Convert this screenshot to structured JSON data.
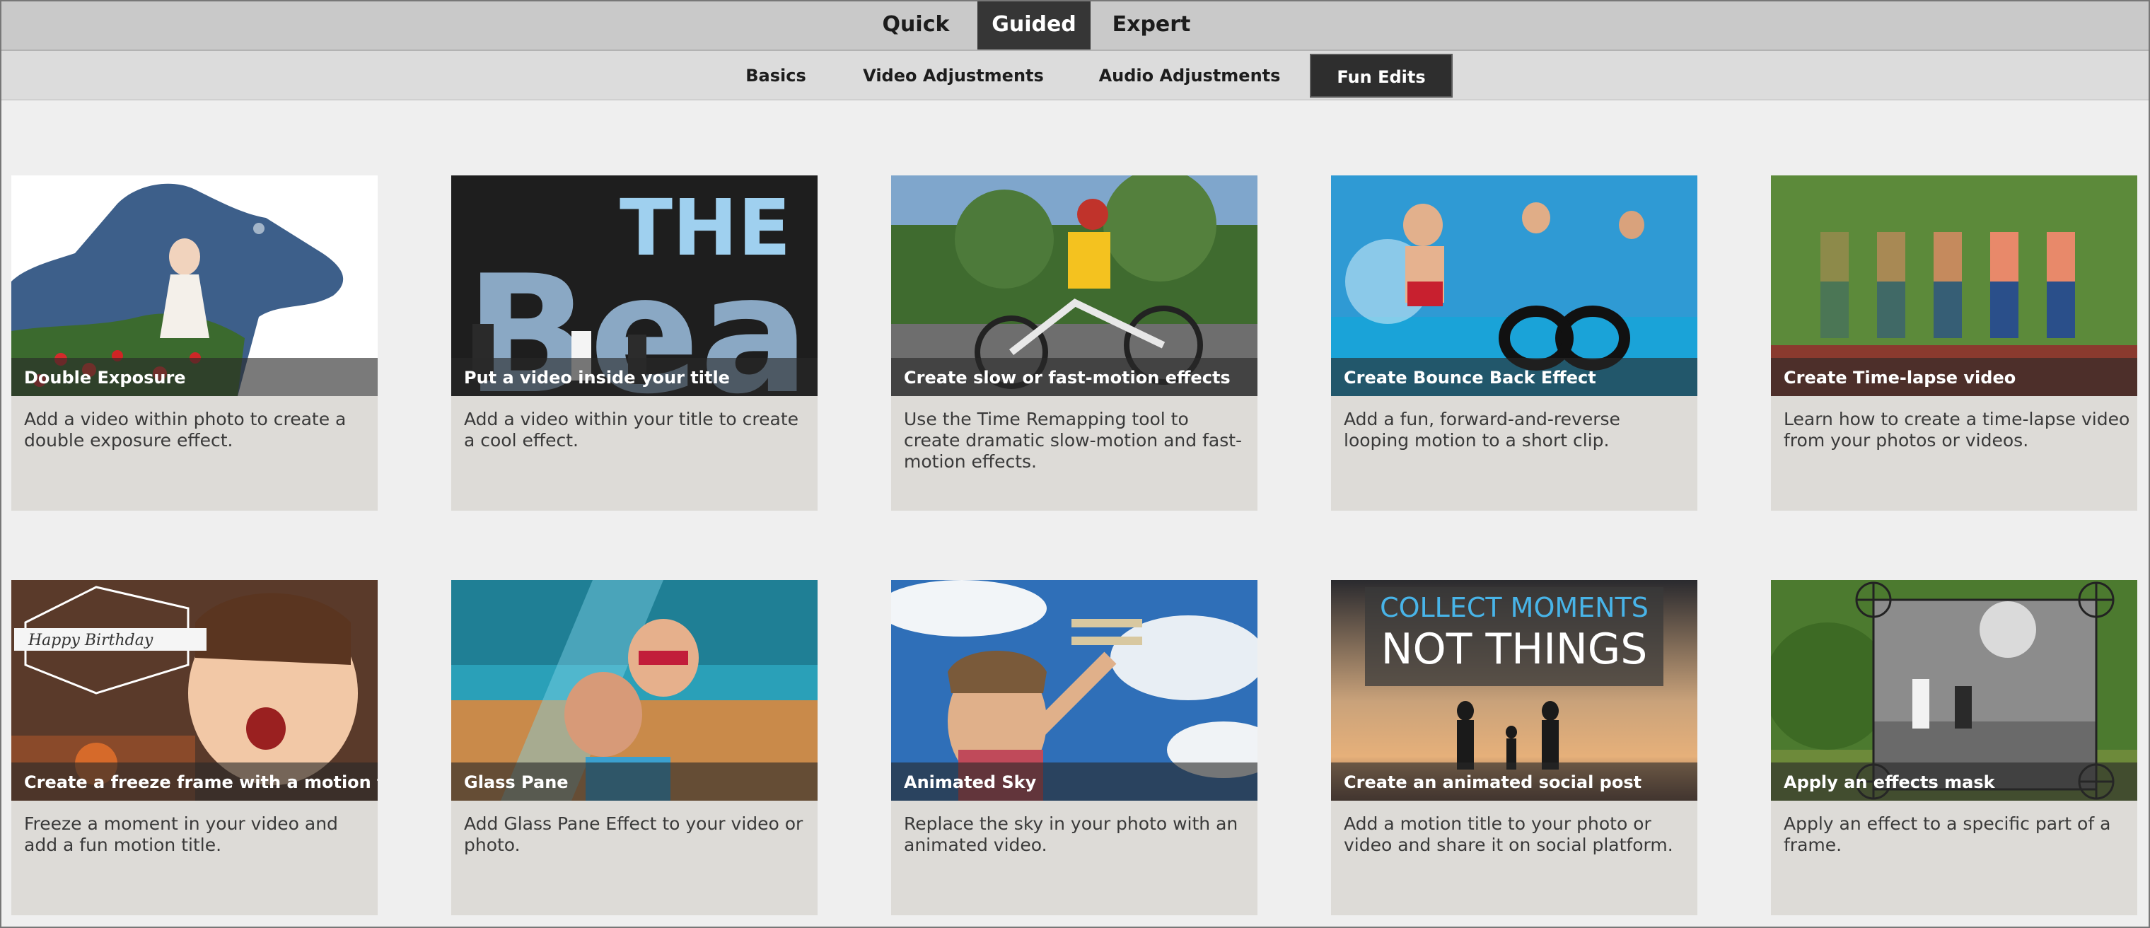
{
  "mode_tabs": [
    {
      "label": "Quick"
    },
    {
      "label": "Guided"
    },
    {
      "label": "Expert"
    }
  ],
  "sub_tabs": [
    {
      "label": "Basics"
    },
    {
      "label": "Video Adjustments"
    },
    {
      "label": "Audio Adjustments"
    },
    {
      "label": "Fun Edits"
    }
  ],
  "active_mode": "Guided",
  "active_sub_tab": "Fun Edits",
  "cards": [
    {
      "title": "Double Exposure",
      "description": "Add a video within photo to create a double exposure effect.",
      "thumb": "dog-silhouette-girl"
    },
    {
      "title": "Put a video inside your title",
      "description": "Add a video within your title to create a cool effect.",
      "thumb": "title-text",
      "thumb_text": [
        "THE",
        "Bea"
      ]
    },
    {
      "title": "Create slow or fast-motion effects",
      "description": "Use the Time Remapping tool to create dramatic slow-motion and fast-motion effects.",
      "thumb": "bike-rider"
    },
    {
      "title": "Create Bounce Back Effect",
      "description": "Add a fun, forward-and-reverse looping motion to a short clip.",
      "thumb": "pool-jump-infinity"
    },
    {
      "title": "Create Time-lapse video",
      "description": "Learn how to create a time-lapse video from your photos or videos.",
      "thumb": "runner-sequence"
    },
    {
      "title": "Create a freeze frame with a motion title",
      "description": "Freeze a moment in your video and add a fun motion title.",
      "thumb": "birthday-child",
      "thumb_text": [
        "Happy Birthday"
      ]
    },
    {
      "title": "Glass Pane",
      "description": "Add Glass Pane Effect to your video or photo.",
      "thumb": "beach-family"
    },
    {
      "title": "Animated Sky",
      "description": "Replace the sky in your photo with an animated video.",
      "thumb": "sky-airplane"
    },
    {
      "title": "Create an animated social post",
      "description": "Add a motion title to your photo or video and share it on social platform.",
      "thumb": "sunset-family",
      "thumb_text": [
        "COLLECT MOMENTS",
        "NOT THINGS"
      ]
    },
    {
      "title": "Apply an effects mask",
      "description": "Apply an effect to a specific part of a frame.",
      "thumb": "mask-frame"
    }
  ]
}
